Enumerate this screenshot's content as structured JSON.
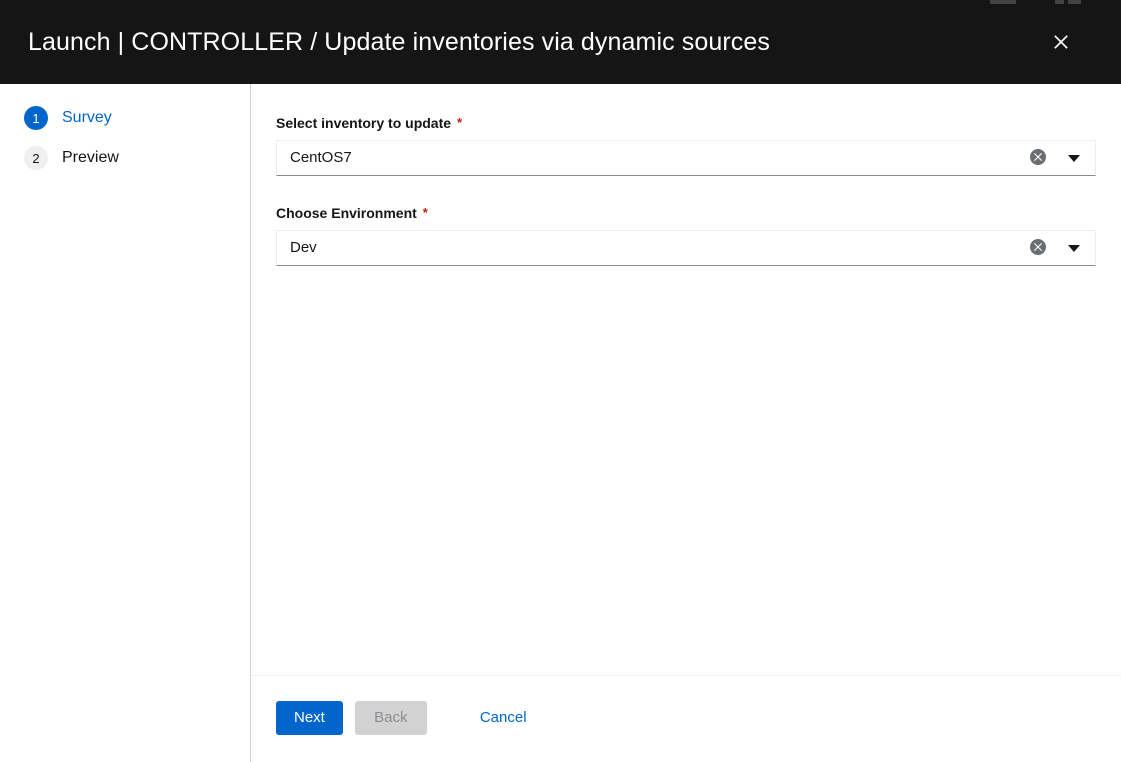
{
  "header": {
    "title": "Launch | CONTROLLER / Update inventories via dynamic sources",
    "close_label": "close-icon",
    "background": "#151515",
    "text_color": "#ffffff"
  },
  "wizard": {
    "steps": [
      {
        "number": "1",
        "label": "Survey",
        "state": "active"
      },
      {
        "number": "2",
        "label": "Preview",
        "state": "inactive"
      }
    ],
    "active_color": "#0066cc",
    "inactive_badge_color": "#f0f0f0"
  },
  "form": {
    "fields": [
      {
        "label": "Select inventory to update",
        "required_mark": "*",
        "value": "CentOS7",
        "clear_icon": "times-circle-icon",
        "toggle_icon": "chevron-down-icon"
      },
      {
        "label": "Choose Environment",
        "required_mark": "*",
        "value": "Dev",
        "clear_icon": "times-circle-icon",
        "toggle_icon": "chevron-down-icon"
      }
    ],
    "required_color": "#c9190b"
  },
  "footer": {
    "next_label": "Next",
    "back_label": "Back",
    "cancel_label": "Cancel",
    "primary_color": "#0066cc",
    "disabled_color": "#d2d2d2"
  }
}
